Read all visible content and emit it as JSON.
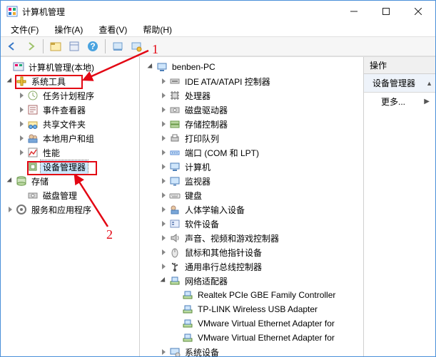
{
  "window": {
    "title": "计算机管理"
  },
  "menubar": [
    "文件(F)",
    "操作(A)",
    "查看(V)",
    "帮助(H)"
  ],
  "toolbar_icons": [
    "back",
    "forward",
    "up",
    "props",
    "help",
    "screen1",
    "screen2"
  ],
  "left_tree": {
    "root": {
      "label": "计算机管理(本地)",
      "icon": "mmc"
    },
    "system_tools": {
      "label": "系统工具",
      "items": [
        {
          "label": "任务计划程序",
          "icon": "task",
          "expandable": true
        },
        {
          "label": "事件查看器",
          "icon": "event",
          "expandable": true
        },
        {
          "label": "共享文件夹",
          "icon": "share",
          "expandable": true
        },
        {
          "label": "本地用户和组",
          "icon": "users",
          "expandable": true
        },
        {
          "label": "性能",
          "icon": "perf",
          "expandable": true
        },
        {
          "label": "设备管理器",
          "icon": "device",
          "expandable": false,
          "selected": true
        }
      ]
    },
    "storage": {
      "label": "存储",
      "items": [
        {
          "label": "磁盘管理",
          "icon": "disk"
        }
      ]
    },
    "services": {
      "label": "服务和应用程序",
      "icon": "services"
    }
  },
  "mid_tree": {
    "root": {
      "label": "benben-PC",
      "icon": "pc"
    },
    "items": [
      {
        "label": "IDE ATA/ATAPI 控制器",
        "icon": "ide",
        "tw": "col"
      },
      {
        "label": "处理器",
        "icon": "cpu",
        "tw": "col"
      },
      {
        "label": "磁盘驱动器",
        "icon": "diskdrv",
        "tw": "col"
      },
      {
        "label": "存储控制器",
        "icon": "stor",
        "tw": "col"
      },
      {
        "label": "打印队列",
        "icon": "print",
        "tw": "col"
      },
      {
        "label": "端口 (COM 和 LPT)",
        "icon": "port",
        "tw": "col"
      },
      {
        "label": "计算机",
        "icon": "pc2",
        "tw": "col"
      },
      {
        "label": "监视器",
        "icon": "mon",
        "tw": "col"
      },
      {
        "label": "键盘",
        "icon": "kb",
        "tw": "col"
      },
      {
        "label": "人体学输入设备",
        "icon": "hid",
        "tw": "col"
      },
      {
        "label": "软件设备",
        "icon": "soft",
        "tw": "col"
      },
      {
        "label": "声音、视频和游戏控制器",
        "icon": "audio",
        "tw": "col"
      },
      {
        "label": "鼠标和其他指针设备",
        "icon": "mouse",
        "tw": "col"
      },
      {
        "label": "通用串行总线控制器",
        "icon": "usb",
        "tw": "col"
      },
      {
        "label": "网络适配器",
        "icon": "net",
        "tw": "exp",
        "children": [
          {
            "label": "Realtek PCIe GBE Family Controller",
            "icon": "neta"
          },
          {
            "label": "TP-LINK Wireless USB Adapter",
            "icon": "neta"
          },
          {
            "label": "VMware Virtual Ethernet Adapter for",
            "icon": "neta"
          },
          {
            "label": "VMware Virtual Ethernet Adapter for",
            "icon": "neta"
          }
        ]
      },
      {
        "label": "系统设备",
        "icon": "sys",
        "tw": "col"
      }
    ]
  },
  "actions": {
    "header": "操作",
    "item": "设备管理器",
    "more": "更多..."
  },
  "annot": {
    "one": "1",
    "two": "2"
  }
}
